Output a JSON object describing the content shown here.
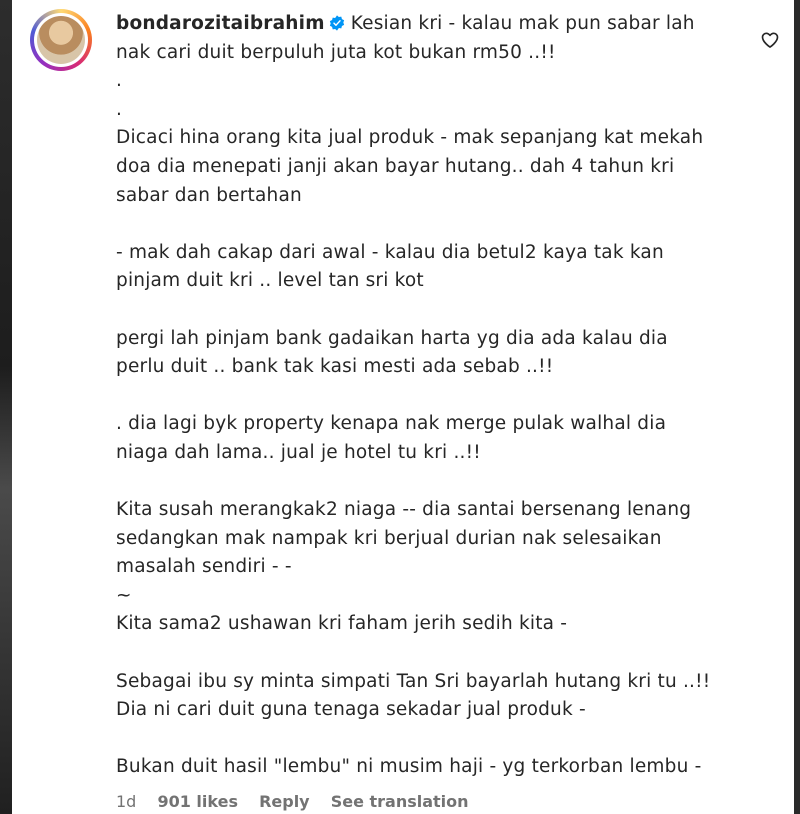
{
  "comment": {
    "username": "bondarozitaibrahim",
    "first_line": "Kesian kri - kalau mak pun sabar lah",
    "lines": [
      "nak cari duit berpuluh juta kot bukan rm50 ..!!",
      ".",
      ".",
      "Dicaci hina orang kita jual produk - mak sepanjang kat mekah",
      "doa dia menepati janji akan bayar hutang.. dah 4 tahun kri",
      "sabar dan bertahan",
      "",
      "- mak dah cakap dari awal - kalau dia betul2 kaya tak kan",
      "pinjam duit kri .. level tan sri kot",
      "",
      "pergi lah pinjam bank gadaikan harta yg dia ada kalau dia",
      "perlu duit .. bank tak kasi mesti ada sebab ..!!",
      "",
      ". dia lagi byk property kenapa nak merge pulak walhal dia",
      "niaga dah lama.. jual je hotel tu kri ..!!",
      "",
      "Kita susah merangkak2 niaga -- dia santai bersenang lenang",
      "sedangkan mak nampak kri berjual durian nak selesaikan",
      "masalah sendiri - -",
      "~",
      "Kita sama2 ushawan kri faham jerih sedih kita -",
      "",
      "Sebagai ibu sy minta simpati Tan Sri bayarlah hutang kri tu ..!!",
      "Dia ni cari duit guna tenaga sekadar jual produk -",
      "",
      "Bukan duit hasil \"lembu\" ni musim haji - yg terkorban lembu -"
    ]
  },
  "meta": {
    "time": "1d",
    "likes": "901 likes",
    "reply": "Reply",
    "translate": "See translation"
  },
  "icons": {
    "verified": "verified-badge-icon",
    "like": "heart-outline-icon"
  },
  "colors": {
    "verified": "#0095f6",
    "meta_text": "#737373"
  }
}
